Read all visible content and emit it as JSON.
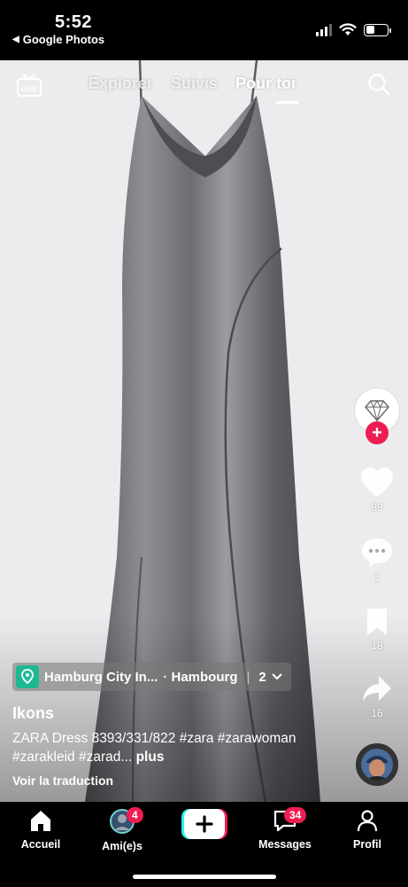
{
  "status_bar": {
    "time": "5:52",
    "back_label": "Google Photos",
    "back_arrow": "◀"
  },
  "top_nav": {
    "live_label": "LIVE",
    "tabs": [
      {
        "label": "Explorer"
      },
      {
        "label": "Suivis"
      },
      {
        "label": "Pour toi",
        "active": true
      }
    ]
  },
  "right_rail": {
    "likes": "99",
    "comments": "1",
    "saves": "18",
    "shares": "16"
  },
  "location": {
    "name": "Hamburg City In...",
    "city": "· Hambourg",
    "count": "2"
  },
  "post": {
    "username": "Ikons",
    "caption": "ZARA Dress 8393/331/822 #zara #zarawoman #zarakleid #zarad...",
    "more": "plus",
    "translate": "Voir la traduction"
  },
  "bottom_nav": {
    "home": "Accueil",
    "friends": "Ami(e)s",
    "friends_badge": "4",
    "messages": "Messages",
    "messages_badge": "34",
    "profile": "Profil"
  },
  "colors": {
    "accent_red": "#ee1d52",
    "cyan": "#25f4ee",
    "location_green": "#1fb894",
    "video_bg": "#ececee"
  }
}
